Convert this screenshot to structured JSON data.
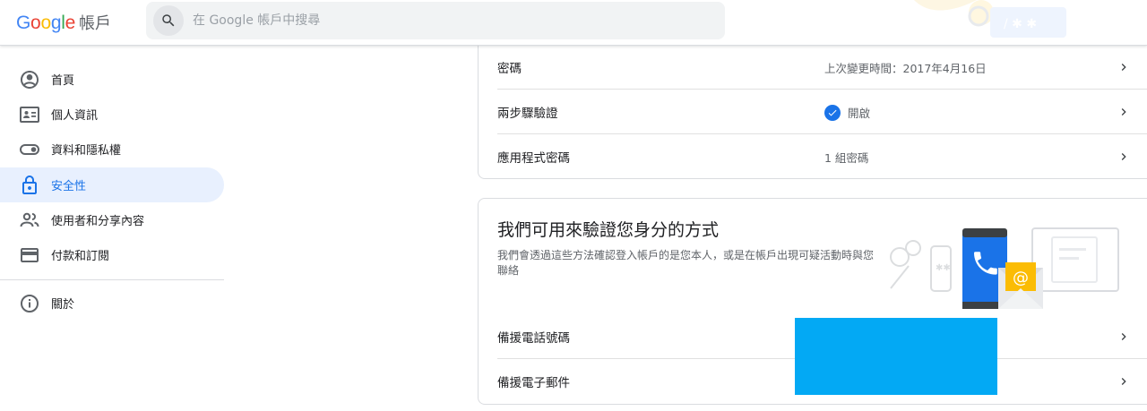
{
  "header": {
    "logo_letters": [
      {
        "ch": "G",
        "color": "#4285F4"
      },
      {
        "ch": "o",
        "color": "#EA4335"
      },
      {
        "ch": "o",
        "color": "#FBBC05"
      },
      {
        "ch": "g",
        "color": "#4285F4"
      },
      {
        "ch": "l",
        "color": "#34A853"
      },
      {
        "ch": "e",
        "color": "#EA4335"
      }
    ],
    "logo_text": "Google",
    "product_name": "帳戶",
    "search_placeholder": "在 Google 帳戶中搜尋"
  },
  "sidebar": {
    "items": [
      {
        "label": "首頁",
        "icon": "home-icon",
        "active": false
      },
      {
        "label": "個人資訊",
        "icon": "person-card-icon",
        "active": false
      },
      {
        "label": "資料和隱私權",
        "icon": "toggle-icon",
        "active": false
      },
      {
        "label": "安全性",
        "icon": "lock-icon",
        "active": true
      },
      {
        "label": "使用者和分享內容",
        "icon": "people-icon",
        "active": false
      },
      {
        "label": "付款和訂閱",
        "icon": "credit-card-icon",
        "active": false
      }
    ],
    "about_label": "關於"
  },
  "signin_card": {
    "rows": [
      {
        "label": "密碼",
        "value": "上次變更時間：2017年4月16日"
      },
      {
        "label": "兩步驟驗證",
        "value": "開啟",
        "checked": true
      },
      {
        "label": "應用程式密碼",
        "value": "1 組密碼"
      }
    ]
  },
  "verify_card": {
    "title": "我們可用來驗證您身分的方式",
    "description": "我們會透過這些方法確認登入帳戶的是您本人，或是在帳戶出現可疑活動時與您聯絡",
    "rows": [
      {
        "label": "備援電話號碼"
      },
      {
        "label": "備援電子郵件"
      }
    ]
  },
  "colors": {
    "accent": "#1a73e8",
    "active_bg": "#e8f0fe",
    "redaction": "#03a9f4"
  }
}
